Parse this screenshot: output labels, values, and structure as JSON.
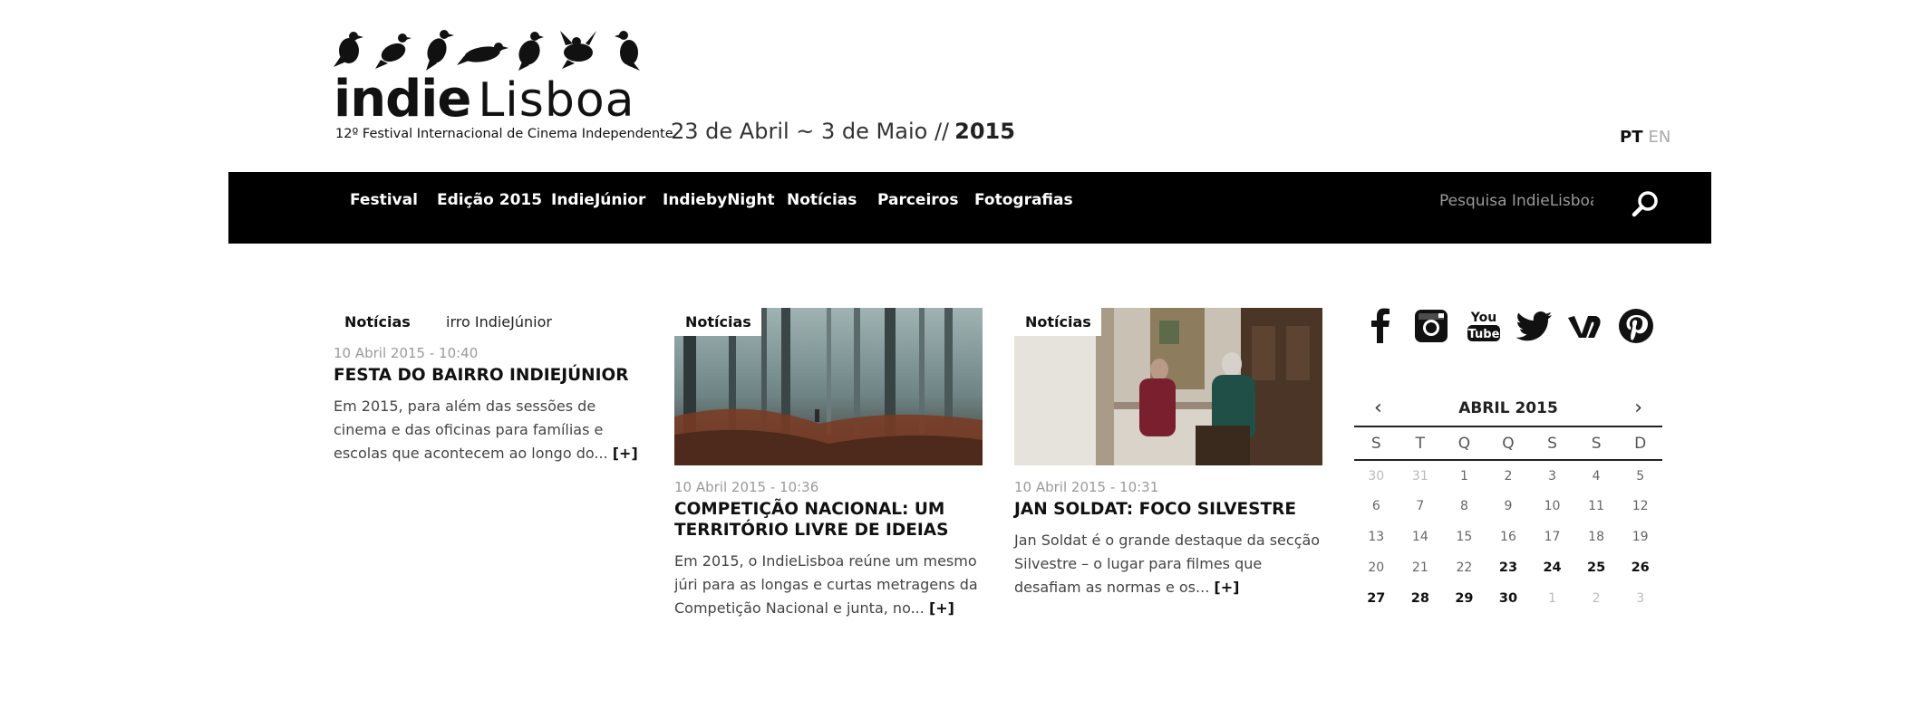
{
  "header": {
    "logo": {
      "word_indie": "indie",
      "word_lisboa": "Lisboa",
      "subtitle": "12º Festival Internacional de Cinema Independente"
    },
    "dates": "23 de Abril ~ 3 de Maio //",
    "year": "2015",
    "lang": {
      "pt": "PT",
      "en": "EN"
    }
  },
  "nav": {
    "items": [
      "Festival",
      "Edição 2015",
      "IndieJúnior",
      "IndiebyNight",
      "Notícias",
      "Parceiros",
      "Fotografias"
    ],
    "search_placeholder": "Pesquisa IndieLisboa",
    "search_icon": "search-icon"
  },
  "articles": [
    {
      "category": "Notícias",
      "ticker": "irro IndieJúnior",
      "date": "10 Abril 2015 - 10:40",
      "title": "FESTA DO BAIRRO INDIEJÚNIOR",
      "excerpt": "Em 2015, para além das sessões de cinema e das oficinas para famílias e escolas que acontecem ao longo do...",
      "more": "[+]"
    },
    {
      "category": "Notícias",
      "date": "10 Abril 2015 - 10:36",
      "title": "COMPETIÇÃO NACIONAL: UM TERRITÓRIO LIVRE DE IDEIAS",
      "excerpt": "Em 2015, o IndieLisboa reúne um mesmo júri para as longas e curtas metragens da Competição Nacional e junta, no...",
      "more": "[+]"
    },
    {
      "category": "Notícias",
      "date": "10 Abril 2015 - 10:31",
      "title": "JAN SOLDAT: FOCO SILVESTRE",
      "excerpt": "Jan Soldat é o grande destaque da secção Silvestre – o lugar para filmes que desafiam as normas e os...",
      "more": "[+]"
    }
  ],
  "social": [
    "facebook-icon",
    "instagram-icon",
    "youtube-icon",
    "twitter-icon",
    "vimeo-icon",
    "pinterest-icon"
  ],
  "youtube_text": {
    "you": "You",
    "tube": "Tube"
  },
  "calendar": {
    "prev": "‹",
    "next": "›",
    "title": "ABRIL 2015",
    "weekdays": [
      "S",
      "T",
      "Q",
      "Q",
      "S",
      "S",
      "D"
    ],
    "weeks": [
      [
        {
          "d": "30",
          "s": "muted"
        },
        {
          "d": "31",
          "s": "muted"
        },
        {
          "d": "1",
          "s": "normal"
        },
        {
          "d": "2",
          "s": "normal"
        },
        {
          "d": "3",
          "s": "normal"
        },
        {
          "d": "4",
          "s": "normal"
        },
        {
          "d": "5",
          "s": "normal"
        }
      ],
      [
        {
          "d": "6",
          "s": "normal"
        },
        {
          "d": "7",
          "s": "normal"
        },
        {
          "d": "8",
          "s": "normal"
        },
        {
          "d": "9",
          "s": "normal"
        },
        {
          "d": "10",
          "s": "normal"
        },
        {
          "d": "11",
          "s": "normal"
        },
        {
          "d": "12",
          "s": "normal"
        }
      ],
      [
        {
          "d": "13",
          "s": "normal"
        },
        {
          "d": "14",
          "s": "normal"
        },
        {
          "d": "15",
          "s": "normal"
        },
        {
          "d": "16",
          "s": "normal"
        },
        {
          "d": "17",
          "s": "normal"
        },
        {
          "d": "18",
          "s": "normal"
        },
        {
          "d": "19",
          "s": "normal"
        }
      ],
      [
        {
          "d": "20",
          "s": "normal"
        },
        {
          "d": "21",
          "s": "normal"
        },
        {
          "d": "22",
          "s": "normal"
        },
        {
          "d": "23",
          "s": "strong"
        },
        {
          "d": "24",
          "s": "strong"
        },
        {
          "d": "25",
          "s": "strong"
        },
        {
          "d": "26",
          "s": "strong"
        }
      ],
      [
        {
          "d": "27",
          "s": "strong"
        },
        {
          "d": "28",
          "s": "strong"
        },
        {
          "d": "29",
          "s": "strong"
        },
        {
          "d": "30",
          "s": "strong"
        },
        {
          "d": "1",
          "s": "muted"
        },
        {
          "d": "2",
          "s": "muted"
        },
        {
          "d": "3",
          "s": "muted"
        }
      ]
    ]
  },
  "colors": {
    "nav_bg": "#000000",
    "nav_text": "#ffffff",
    "muted_text": "#9a9a9a"
  }
}
